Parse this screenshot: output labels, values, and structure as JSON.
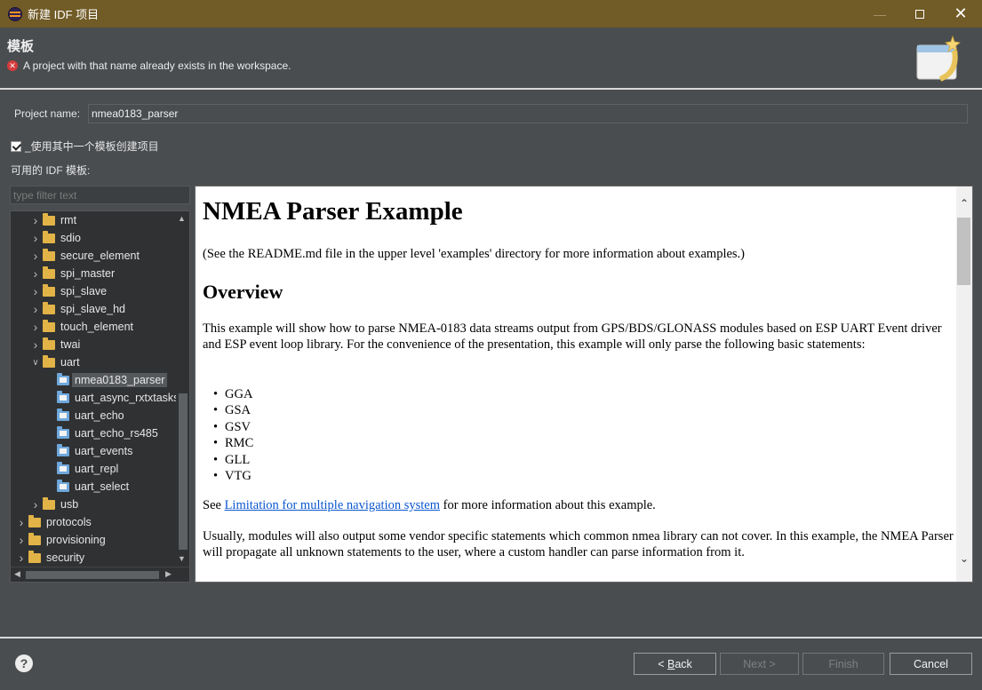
{
  "window": {
    "title": "新建 IDF 项目",
    "icon": "eclipse-icon"
  },
  "banner": {
    "title": "模板",
    "message": "A project with that name already exists in the workspace."
  },
  "project_name": {
    "label": "Project name:",
    "value": "nmea0183_parser"
  },
  "use_template": {
    "label": "_使用其中一个模板创建项目",
    "checked": true
  },
  "available_label": "可用的 IDF 模板:",
  "filter": {
    "placeholder": "type filter text"
  },
  "tree": {
    "items": [
      {
        "label": "rmt",
        "level": 1,
        "type": "folder",
        "expanded": false
      },
      {
        "label": "sdio",
        "level": 1,
        "type": "folder",
        "expanded": false
      },
      {
        "label": "secure_element",
        "level": 1,
        "type": "folder",
        "expanded": false
      },
      {
        "label": "spi_master",
        "level": 1,
        "type": "folder",
        "expanded": false
      },
      {
        "label": "spi_slave",
        "level": 1,
        "type": "folder",
        "expanded": false
      },
      {
        "label": "spi_slave_hd",
        "level": 1,
        "type": "folder",
        "expanded": false
      },
      {
        "label": "touch_element",
        "level": 1,
        "type": "folder",
        "expanded": false
      },
      {
        "label": "twai",
        "level": 1,
        "type": "folder",
        "expanded": false
      },
      {
        "label": "uart",
        "level": 1,
        "type": "folder",
        "expanded": true
      },
      {
        "label": "nmea0183_parser",
        "level": 2,
        "type": "project",
        "selected": true
      },
      {
        "label": "uart_async_rxtxtasks",
        "level": 2,
        "type": "project"
      },
      {
        "label": "uart_echo",
        "level": 2,
        "type": "project"
      },
      {
        "label": "uart_echo_rs485",
        "level": 2,
        "type": "project"
      },
      {
        "label": "uart_events",
        "level": 2,
        "type": "project"
      },
      {
        "label": "uart_repl",
        "level": 2,
        "type": "project"
      },
      {
        "label": "uart_select",
        "level": 2,
        "type": "project"
      },
      {
        "label": "usb",
        "level": 1,
        "type": "folder",
        "expanded": false
      },
      {
        "label": "protocols",
        "level": 0,
        "type": "folder",
        "expanded": false
      },
      {
        "label": "provisioning",
        "level": 0,
        "type": "folder",
        "expanded": false
      },
      {
        "label": "security",
        "level": 0,
        "type": "folder",
        "expanded": false
      }
    ]
  },
  "readme": {
    "title": "NMEA Parser Example",
    "intro": "(See the README.md file in the upper level 'examples' directory for more information about examples.)",
    "overview_heading": "Overview",
    "overview_text": "This example will show how to parse NMEA-0183 data streams output from GPS/BDS/GLONASS modules based on ESP UART Event driver and ESP event loop library. For the convenience of the presentation, this example will only parse the following basic statements:",
    "statements": [
      "GGA",
      "GSA",
      "GSV",
      "RMC",
      "GLL",
      "VTG"
    ],
    "see_prefix": "See ",
    "see_link": "Limitation for multiple navigation system",
    "see_suffix": " for more information about this example.",
    "usually_text": "Usually, modules will also output some vendor specific statements which common nmea library can not cover. In this example, the NMEA Parser will propagate all unknown statements to the user, where a custom handler can parse information from it."
  },
  "buttons": {
    "back_prefix": "< ",
    "back_mnemonic": "B",
    "back_rest": "ack",
    "next": "Next >",
    "finish": "Finish",
    "cancel": "Cancel"
  },
  "colors": {
    "titlebar": "#715b26",
    "background": "#4a4d50",
    "error": "#d63b3b",
    "link": "#0b57d0"
  }
}
